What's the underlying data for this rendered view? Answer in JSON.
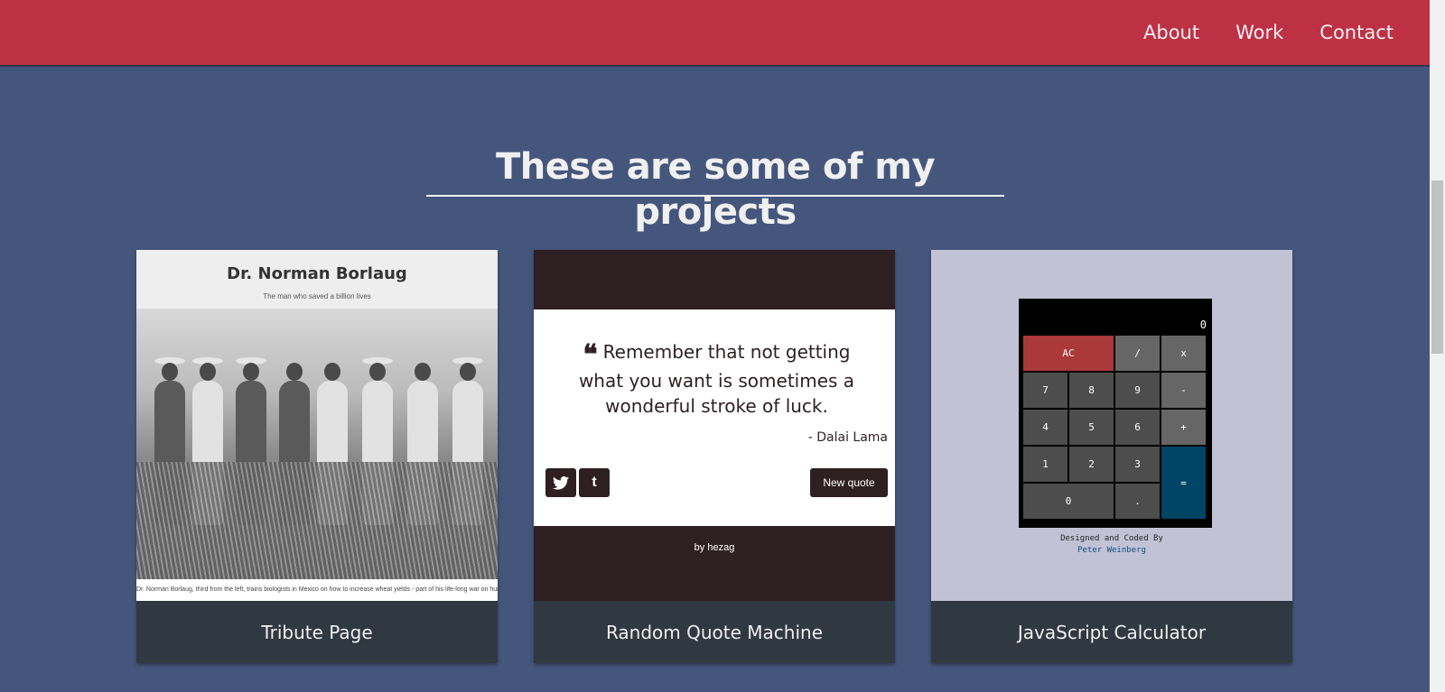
{
  "nav": {
    "links": [
      "About",
      "Work",
      "Contact"
    ]
  },
  "section": {
    "heading": "These are some of my projects"
  },
  "projects": [
    {
      "title": "Tribute Page",
      "preview": {
        "heading": "Dr. Norman Borlaug",
        "subtitle": "The man who saved a billion lives",
        "caption": "Dr. Norman Borlaug, third from the left, trains biologists in Mexico on how to increase wheat yields - part of his life-long war on hunger."
      }
    },
    {
      "title": "Random Quote Machine",
      "preview": {
        "quote": "Remember that not getting what you want is sometimes a wonderful stroke of luck.",
        "author": "- Dalai Lama",
        "twitter_icon": "twitter-icon",
        "tumblr_icon": "tumblr-icon",
        "new_quote_label": "New quote",
        "credit": "by hezag"
      }
    },
    {
      "title": "JavaScript Calculator",
      "preview": {
        "display": "0",
        "keys": [
          "AC",
          "/",
          "x",
          "7",
          "8",
          "9",
          "-",
          "4",
          "5",
          "6",
          "+",
          "1",
          "2",
          "3",
          "=",
          "0",
          "."
        ],
        "credit_line": "Designed and Coded By",
        "credit_name": "Peter Weinberg"
      }
    }
  ],
  "colors": {
    "nav": "#be3144",
    "background": "#45567d",
    "card_title_bg": "#303841"
  }
}
